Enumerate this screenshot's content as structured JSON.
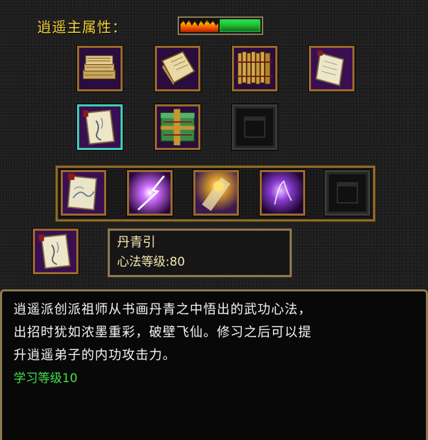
{
  "header": {
    "title": "逍遥主属性：",
    "attr_bar": {
      "fire_fill": 0.47,
      "green_fill": 0.53,
      "colors": [
        "#ff6a00",
        "#2fff4c"
      ]
    }
  },
  "grid": {
    "row1": [
      {
        "name": "book-stack-icon",
        "empty": false
      },
      {
        "name": "manual-icon",
        "empty": false
      },
      {
        "name": "bamboo-scroll-icon",
        "empty": false
      },
      {
        "name": "paper-scroll-icon",
        "empty": false
      }
    ],
    "row2": [
      {
        "name": "ink-scroll-icon",
        "empty": false,
        "selected": true
      },
      {
        "name": "tied-book-icon",
        "empty": false
      },
      {
        "name": "empty-slot",
        "empty": true
      }
    ],
    "row3": [
      {
        "name": "painting-scroll-icon",
        "empty": false
      },
      {
        "name": "purple-flash-icon",
        "empty": false
      },
      {
        "name": "golden-burst-icon",
        "empty": false
      },
      {
        "name": "violet-aura-icon",
        "empty": false
      },
      {
        "name": "empty-slot",
        "empty": true
      }
    ]
  },
  "selected_skill": {
    "icon": "ink-scroll-icon",
    "name": "丹青引",
    "level_text": "心法等级:80"
  },
  "description": {
    "lines": [
      "逍遥派创派祖师从书画丹青之中悟出的武功心法，",
      "出招时犹如浓墨重彩，破壁飞仙。修习之后可以提",
      "升逍遥弟子的内功攻击力。"
    ],
    "requirement": "学习等级10",
    "text_color": "#f4f4f4",
    "requirement_color": "#44e04a"
  }
}
